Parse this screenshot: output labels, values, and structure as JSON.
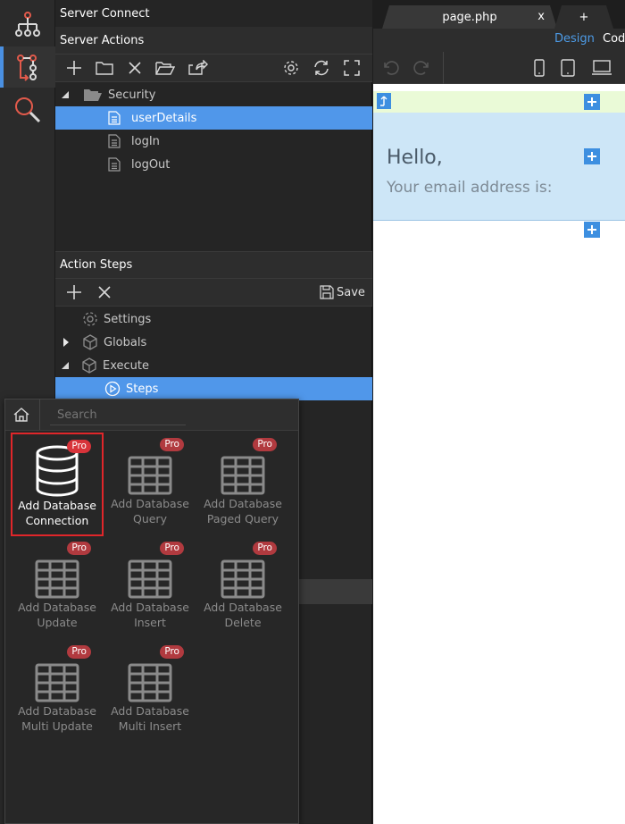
{
  "rail": {
    "icons": [
      "sitemap-icon",
      "server-connect-icon",
      "search-icon"
    ]
  },
  "panel": {
    "title": "Server Connect",
    "server_actions": {
      "header": "Server Actions",
      "toolbar_icons": [
        "add-icon",
        "folder-icon",
        "delete-icon",
        "open-folder-icon",
        "export-icon",
        "settings-icon",
        "refresh-icon",
        "fullscreen-icon"
      ],
      "tree": [
        {
          "label": "Security",
          "type": "folder",
          "expanded": true
        },
        {
          "label": "userDetails",
          "type": "file",
          "selected": true
        },
        {
          "label": "logIn",
          "type": "file"
        },
        {
          "label": "logOut",
          "type": "file"
        }
      ]
    },
    "action_steps": {
      "header": "Action Steps",
      "save_label": "Save",
      "tree": [
        {
          "label": "Settings",
          "icon": "gear-icon"
        },
        {
          "label": "Globals",
          "icon": "cube-icon",
          "collapsed": true
        },
        {
          "label": "Execute",
          "icon": "cube-icon",
          "expanded": true
        },
        {
          "label": "Steps",
          "icon": "play-circle-icon",
          "selected": true
        }
      ]
    }
  },
  "editor": {
    "tabs": [
      {
        "label": "page.php",
        "close": "x"
      },
      {
        "label": "+"
      }
    ],
    "view_modes": {
      "design": "Design",
      "code": "Code"
    },
    "canvas": {
      "heading": "Hello,",
      "subtext": "Your email address is:"
    }
  },
  "popup": {
    "search_placeholder": "Search",
    "tiles": [
      {
        "label": "Add Database Connection",
        "icon": "database-icon",
        "badge": "Pro",
        "active": true
      },
      {
        "label": "Add Database Query",
        "icon": "table-icon",
        "badge": "Pro"
      },
      {
        "label": "Add Database Paged Query",
        "icon": "table-icon",
        "badge": "Pro"
      },
      {
        "label": "Add Database Update",
        "icon": "table-icon",
        "badge": "Pro"
      },
      {
        "label": "Add Database Insert",
        "icon": "table-icon",
        "badge": "Pro"
      },
      {
        "label": "Add Database Delete",
        "icon": "table-icon",
        "badge": "Pro"
      },
      {
        "label": "Add Database Multi Update",
        "icon": "table-icon",
        "badge": "Pro"
      },
      {
        "label": "Add Database Multi Insert",
        "icon": "table-icon",
        "badge": "Pro"
      }
    ]
  },
  "colors": {
    "selection": "#5097ea",
    "accent": "#4a90e2",
    "pro_badge": "#b13a3f",
    "highlight_border": "#e0262a",
    "canvas_band": "#cde6f7",
    "canvas_topbar": "#eafad7"
  }
}
